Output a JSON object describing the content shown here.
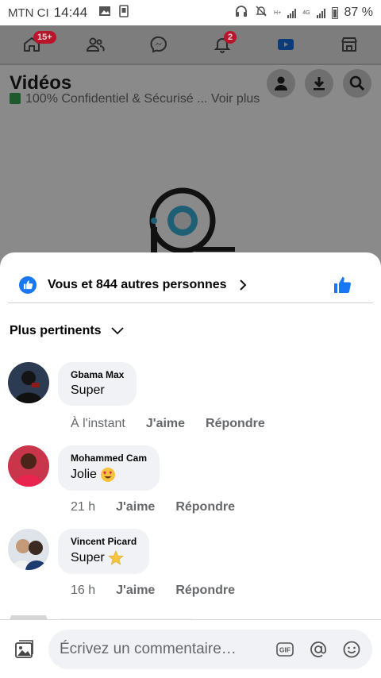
{
  "status_bar": {
    "carrier": "MTN CI",
    "time": "14:44",
    "battery": "87 %",
    "net_labels": [
      "H+",
      "4G"
    ]
  },
  "background_app": {
    "nav": [
      {
        "name": "home-icon",
        "badge": "15+"
      },
      {
        "name": "friends-icon",
        "badge": ""
      },
      {
        "name": "messenger-icon",
        "badge": ""
      },
      {
        "name": "bell-icon",
        "badge": "2"
      },
      {
        "name": "watch-icon",
        "badge": ""
      },
      {
        "name": "marketplace-icon",
        "badge": ""
      }
    ],
    "page_title": "Vidéos",
    "faded_text": "100% Confidentiel & Sécurisé ... Voir plus"
  },
  "sheet": {
    "reactions_text": "Vous et 844 autres personnes",
    "sort_label": "Plus pertinents",
    "comments": [
      {
        "author": "Gbama Max",
        "text": "Super",
        "emoji": "",
        "time": "À l'instant",
        "like": "J'aime",
        "reply": "Répondre"
      },
      {
        "author": "Mohammed Cam",
        "text": "Jolie",
        "emoji": "heart-eyes-emoji",
        "time": "21 h",
        "like": "J'aime",
        "reply": "Répondre"
      },
      {
        "author": "Vincent Picard",
        "text": "Super",
        "emoji": "star-emoji",
        "time": "16 h",
        "like": "J'aime",
        "reply": "Répondre"
      }
    ],
    "composer": {
      "placeholder": "Écrivez un commentaire…",
      "gif_label": "GIF"
    }
  },
  "colors": {
    "facebook_blue": "#1877f2",
    "badge_red": "#b8152b",
    "bubble_bg": "#f0f2f5",
    "secondary_text": "#65676b"
  }
}
